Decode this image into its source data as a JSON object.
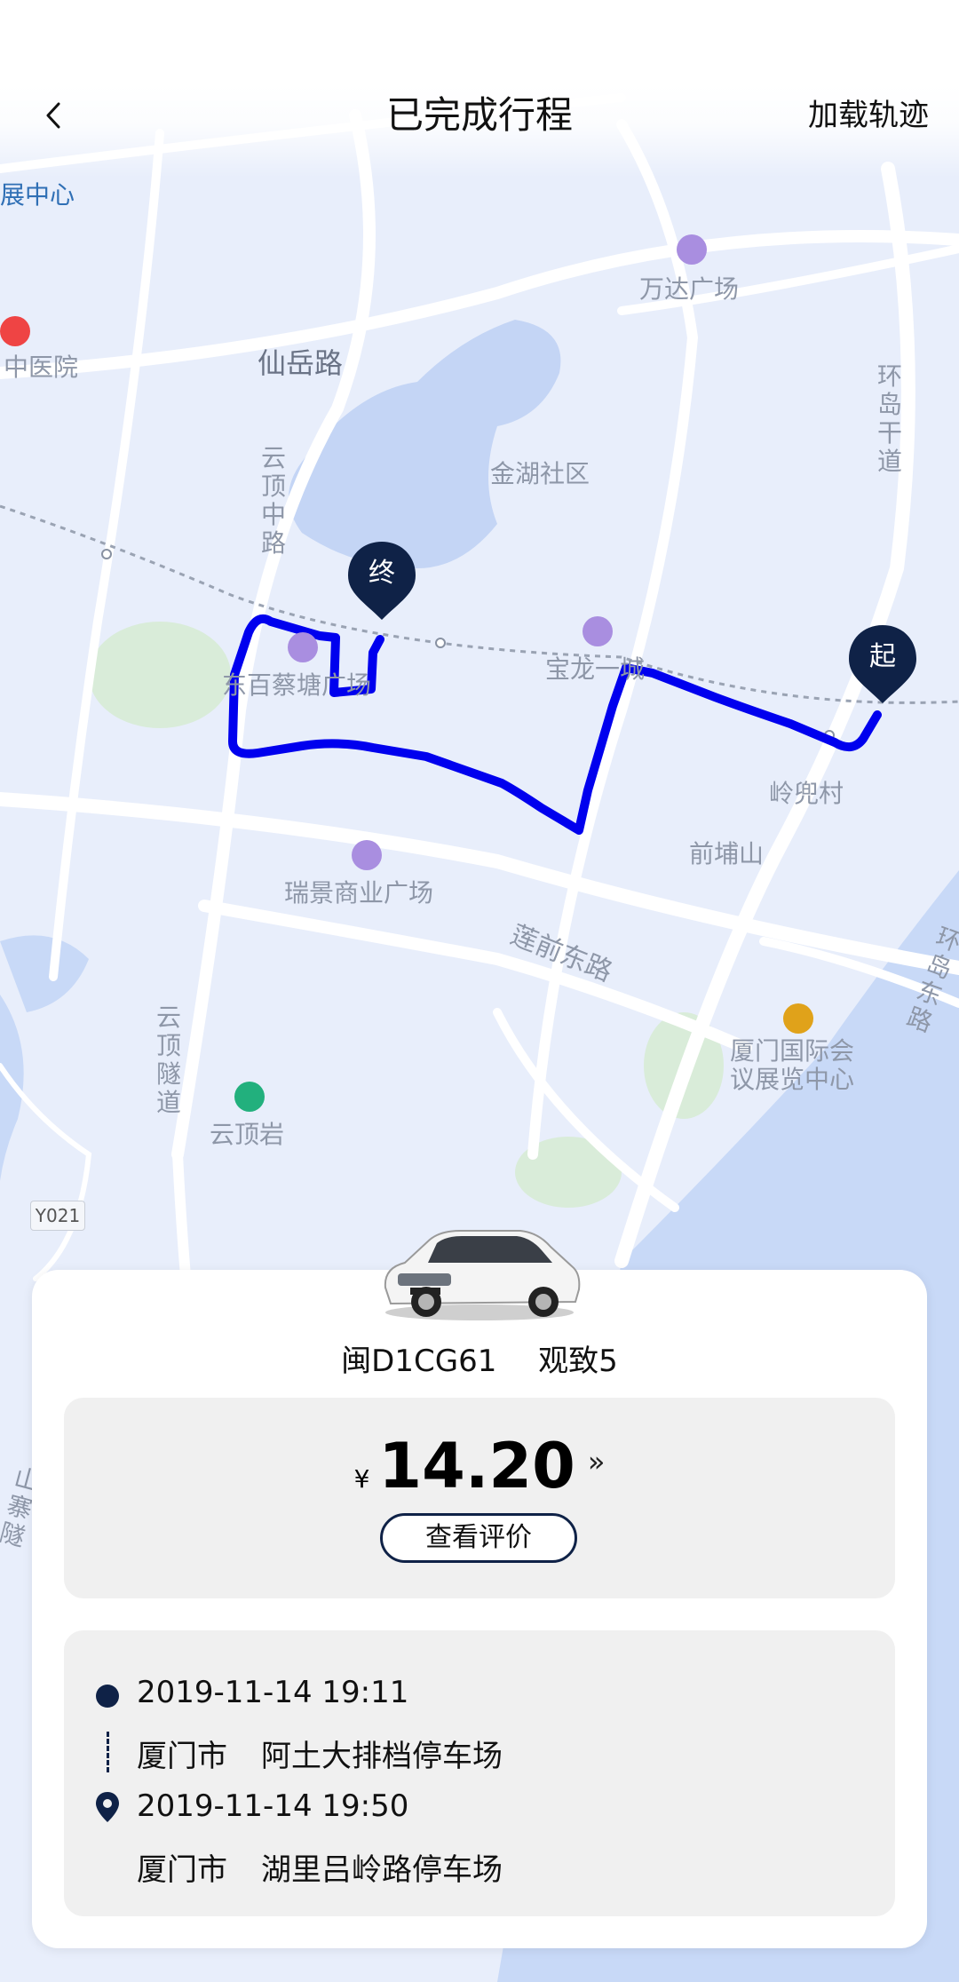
{
  "header": {
    "title": "已完成行程",
    "right_action": "加载轨迹"
  },
  "map": {
    "labels": {
      "center_partial": "展中心",
      "hospital": "中医院",
      "xianyue_road": "仙岳路",
      "wanda": "万达广场",
      "jinhu": "金湖社区",
      "huandao_gan": "环岛干道",
      "yunding_zhong": "云顶中路",
      "dongbai": "东百蔡塘广场",
      "baolong": "宝龙一城",
      "lingdou": "岭兜村",
      "qianpu": "前埔山",
      "ruijing": "瑞景商业广场",
      "lianqian_dong": "莲前东路",
      "huandao_dong": "环岛东路",
      "conference": "厦门国际会议展览中心",
      "yunding_tunnel": "云顶隧道",
      "yundingyan": "云顶岩",
      "road_code": "Y021",
      "shanzhai": "山寨隧"
    },
    "markers": {
      "start": "起",
      "end": "终"
    },
    "colors": {
      "route": "#0000ee",
      "marker": "#0f2247"
    }
  },
  "trip": {
    "plate": "闽D1CG61",
    "model": "观致5",
    "currency": "¥",
    "amount": "14.20",
    "more_icon": "»",
    "review_button": "查看评价",
    "start_time": "2019-11-14 19:11",
    "start_city": "厦门市",
    "start_place": "阿土大排档停车场",
    "end_time": "2019-11-14 19:50",
    "end_city": "厦门市",
    "end_place": "湖里吕岭路停车场"
  }
}
